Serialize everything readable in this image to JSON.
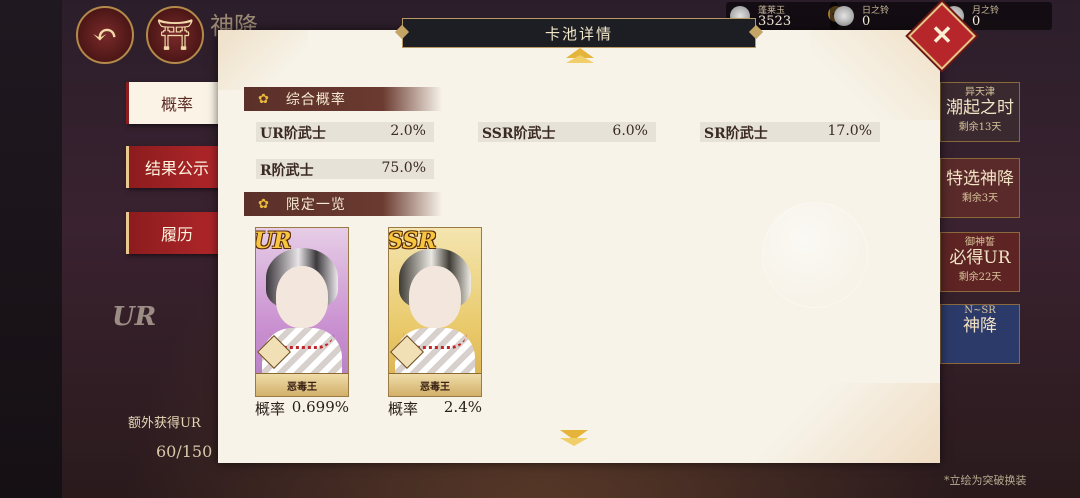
{
  "background": {
    "title": "神降",
    "extra_gain_label": "额外获得UR",
    "progress_text": "60/150",
    "ur_mark": "UR",
    "tip": "*立绘为突破换装",
    "currencies": [
      {
        "label": "蓬莱玉",
        "value": "3523"
      },
      {
        "label": "日之铃",
        "value": "0"
      },
      {
        "label": "月之铃",
        "value": "0"
      }
    ],
    "banners": [
      {
        "title": "异天津",
        "name": "潮起之时",
        "remain": "剩余13天"
      },
      {
        "title": "",
        "name": "特选神降",
        "remain": "剩余3天"
      },
      {
        "title": "御神誓",
        "name": "必得UR",
        "remain": "剩余22天"
      },
      {
        "title": "N~SR",
        "name": "神降",
        "remain": ""
      }
    ]
  },
  "tabs": [
    {
      "label": "概率",
      "active": true
    },
    {
      "label": "结果公示",
      "active": false
    },
    {
      "label": "履历",
      "active": false
    }
  ],
  "modal": {
    "title": "卡池详情",
    "close_icon": "close-x-icon",
    "section_rates": "综合概率",
    "rates": [
      {
        "name": "UR阶武士",
        "value": "2.0%"
      },
      {
        "name": "SSR阶武士",
        "value": "6.0%"
      },
      {
        "name": "SR阶武士",
        "value": "17.0%"
      },
      {
        "name": "R阶武士",
        "value": "75.0%"
      }
    ],
    "section_limited": "限定一览",
    "cards": [
      {
        "rank": "UR",
        "name": "恶毒王",
        "prob_label": "概率",
        "prob": "0.699%"
      },
      {
        "rank": "SSR",
        "name": "恶毒王",
        "prob_label": "概率",
        "prob": "2.4%"
      }
    ]
  },
  "colors": {
    "accent_red": "#b3272a",
    "gold": "#e5b43a",
    "panel": "#f7f3e9"
  }
}
